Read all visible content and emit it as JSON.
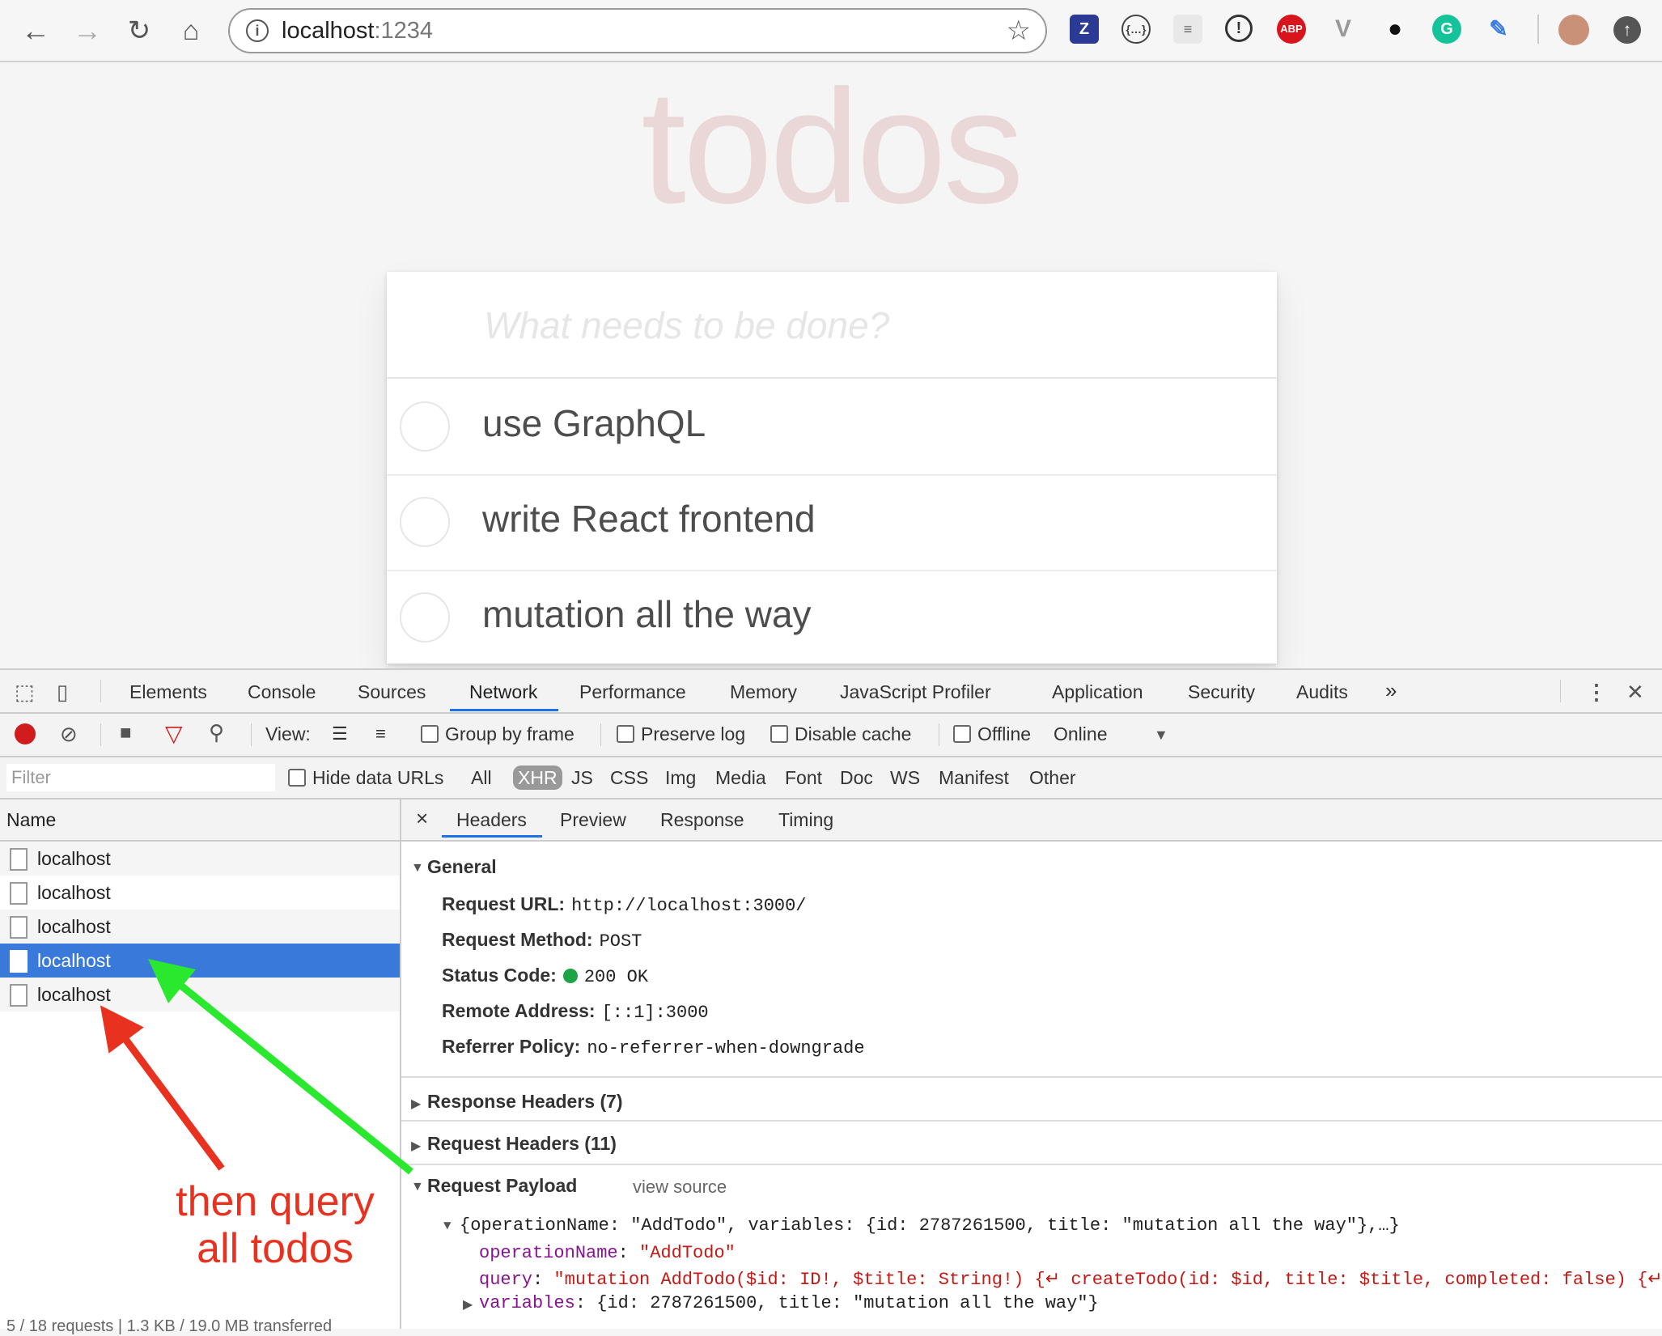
{
  "browser": {
    "url_host": "localhost",
    "url_port": ":1234",
    "extensions": [
      "Z",
      "{…}",
      "≡",
      "!",
      "ABP",
      "V",
      "●",
      "G",
      "✎"
    ]
  },
  "todo": {
    "title": "todos",
    "placeholder": "What needs to be done?",
    "items": [
      "use GraphQL",
      "write React frontend",
      "mutation all the way"
    ]
  },
  "devtools": {
    "tabs": [
      "Elements",
      "Console",
      "Sources",
      "Network",
      "Performance",
      "Memory",
      "JavaScript Profiler",
      "Application",
      "Security",
      "Audits"
    ],
    "active_tab": "Network",
    "more_tabs": "»",
    "toolbar": {
      "view_label": "View:",
      "group_by_frame": "Group by frame",
      "preserve_log": "Preserve log",
      "disable_cache": "Disable cache",
      "offline": "Offline",
      "throttle": "Online"
    },
    "filter": {
      "placeholder": "Filter",
      "hide_data_urls": "Hide data URLs",
      "types": [
        "All",
        "XHR",
        "JS",
        "CSS",
        "Img",
        "Media",
        "Font",
        "Doc",
        "WS",
        "Manifest",
        "Other"
      ],
      "selected": "XHR"
    },
    "requests": {
      "header": "Name",
      "rows": [
        "localhost",
        "localhost",
        "localhost",
        "localhost",
        "localhost"
      ],
      "selected_index": 3,
      "status_line": "5 / 18 requests | 1.3 KB / 19.0 MB transferred"
    },
    "detail": {
      "close": "×",
      "tabs": [
        "Headers",
        "Preview",
        "Response",
        "Timing"
      ],
      "active_tab": "Headers",
      "general": {
        "title": "General",
        "request_url_label": "Request URL:",
        "request_url": "http://localhost:3000/",
        "request_method_label": "Request Method:",
        "request_method": "POST",
        "status_code_label": "Status Code:",
        "status_code": "200 OK",
        "remote_address_label": "Remote Address:",
        "remote_address": "[::1]:3000",
        "referrer_policy_label": "Referrer Policy:",
        "referrer_policy": "no-referrer-when-downgrade"
      },
      "response_headers": "Response Headers (7)",
      "request_headers": "Request Headers (11)",
      "request_payload": "Request Payload",
      "view_source": "view source",
      "payload": {
        "summary": "{operationName: \"AddTodo\", variables: {id: 2787261500, title: \"mutation all the way\"},…}",
        "operation_key": "operationName",
        "operation_value": "\"AddTodo\"",
        "query_key": "query",
        "query_value": "\"mutation AddTodo($id: ID!, $title: String!) {↵  createTodo(id: $id, title: $title, completed: false) {↵",
        "variables_key": "variables",
        "variables_value": "{id: 2787261500, title: \"mutation all the way\"}"
      }
    }
  },
  "annotation": {
    "line1": "then query",
    "line2": "all todos",
    "color": "#e8321f",
    "arrow_colors": [
      "#e8321f",
      "#29e82e"
    ]
  }
}
